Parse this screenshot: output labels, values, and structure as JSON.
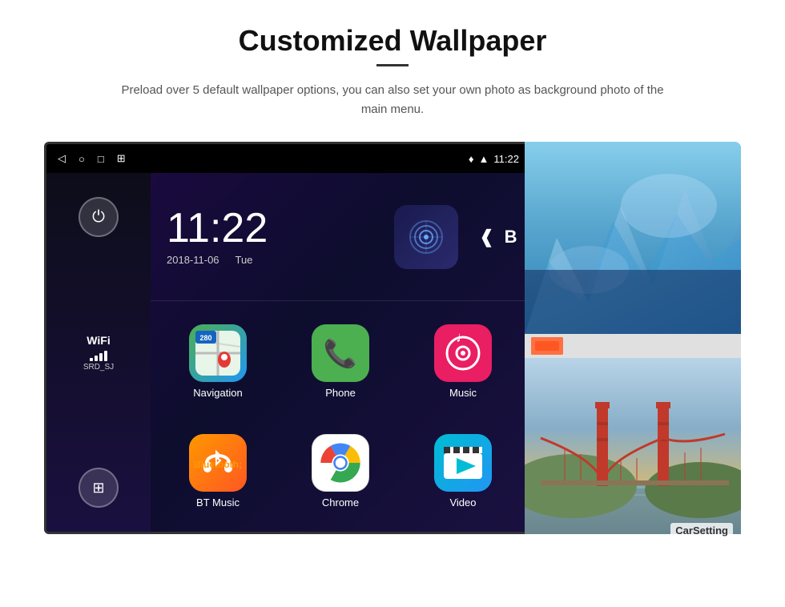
{
  "header": {
    "title": "Customized Wallpaper",
    "underline": true,
    "description": "Preload over 5 default wallpaper options, you can also set your own photo as background photo of the main menu."
  },
  "device": {
    "status_bar": {
      "left_icons": [
        "◁",
        "○",
        "□",
        "⊞"
      ],
      "right_icons": [
        "location",
        "wifi",
        "signal"
      ],
      "time": "11:22"
    },
    "clock": {
      "time": "11:22",
      "date": "2018-11-06",
      "day": "Tue"
    },
    "sidebar": {
      "power_icon": "⏻",
      "wifi_label": "WiFi",
      "wifi_bars": [
        4,
        8,
        12,
        14
      ],
      "wifi_ssid": "SRD_SJ",
      "apps_grid_icon": "⊞"
    },
    "apps": [
      {
        "id": "navigation",
        "label": "Navigation",
        "icon_type": "navigation"
      },
      {
        "id": "phone",
        "label": "Phone",
        "icon_type": "phone"
      },
      {
        "id": "music",
        "label": "Music",
        "icon_type": "music"
      },
      {
        "id": "btmusic",
        "label": "BT Music",
        "icon_type": "btmusic"
      },
      {
        "id": "chrome",
        "label": "Chrome",
        "icon_type": "chrome"
      },
      {
        "id": "video",
        "label": "Video",
        "icon_type": "video"
      }
    ],
    "map_badge": "280"
  },
  "wallpapers": {
    "top_label": "ice cave",
    "bottom_label": "golden gate bridge",
    "carsetting_label": "CarSetting"
  }
}
